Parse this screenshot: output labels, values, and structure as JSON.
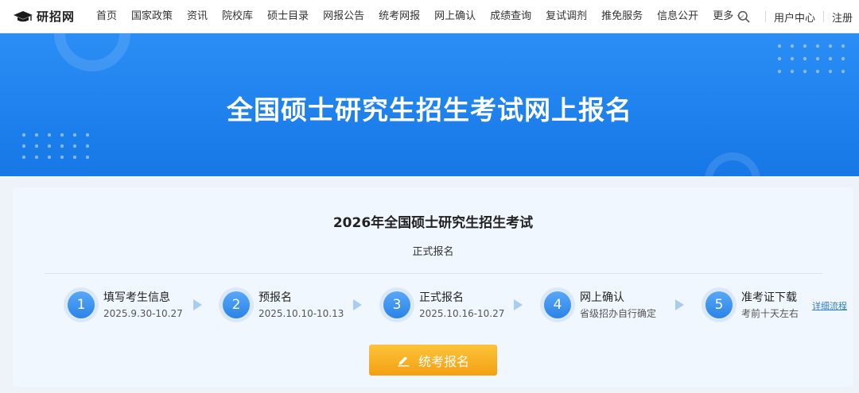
{
  "nav": {
    "logo_text": "研招网",
    "items": [
      "首页",
      "国家政策",
      "资讯",
      "院校库",
      "硕士目录",
      "网报公告",
      "统考网报",
      "网上确认",
      "成绩查询",
      "复试调剂",
      "推免服务",
      "信息公开"
    ],
    "more_label": "更多",
    "user_center": "用户中心",
    "register": "注册"
  },
  "banner": {
    "title": "全国硕士研究生招生考试网上报名"
  },
  "card": {
    "title": "2026年全国硕士研究生招生考试",
    "subtitle": "正式报名",
    "steps": [
      {
        "num": "1",
        "name": "填写考生信息",
        "date": "2025.9.30-10.27"
      },
      {
        "num": "2",
        "name": "预报名",
        "date": "2025.10.10-10.13"
      },
      {
        "num": "3",
        "name": "正式报名",
        "date": "2025.10.16-10.27"
      },
      {
        "num": "4",
        "name": "网上确认",
        "date": "省级招办自行确定"
      },
      {
        "num": "5",
        "name": "准考证下载",
        "date": "考前十天左右"
      }
    ],
    "detail_link": "详细流程",
    "apply_button": "统考报名"
  },
  "colors": {
    "banner": "#1f84ee",
    "step_circle": "#2a83e8",
    "button": "#f6ab1c"
  }
}
